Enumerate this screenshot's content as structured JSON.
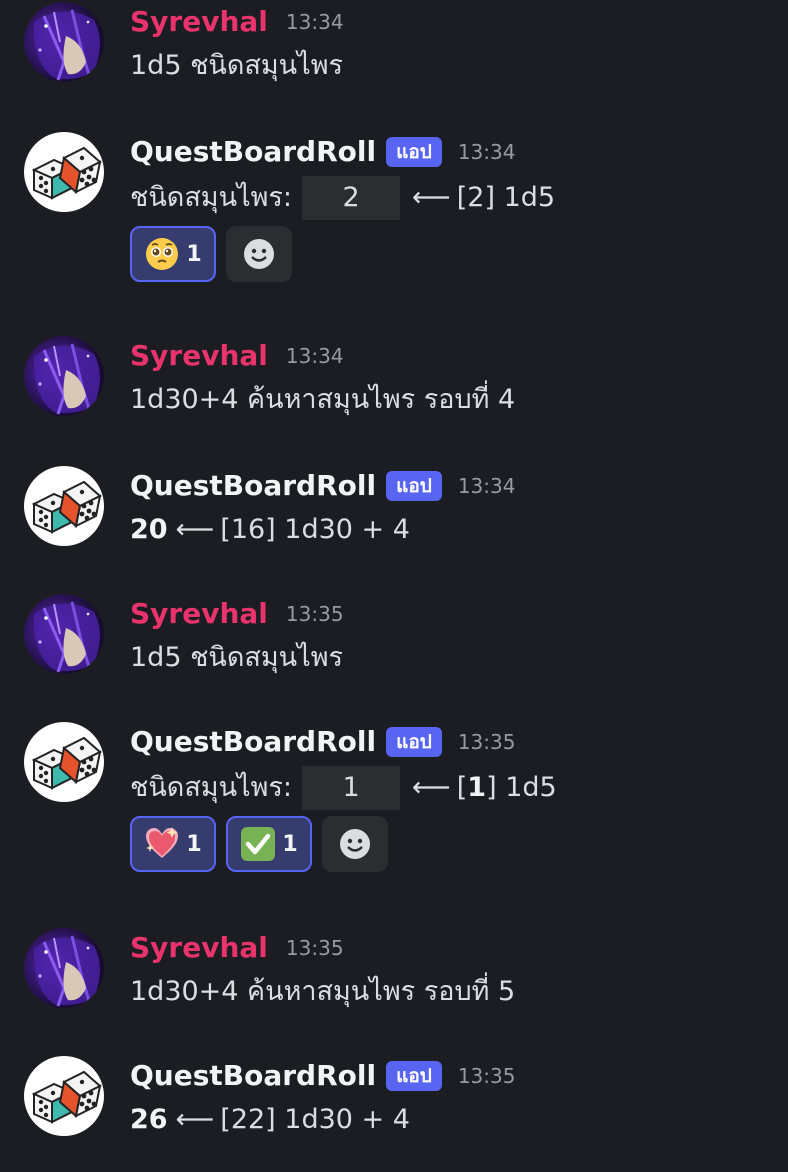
{
  "messages": [
    {
      "author": "Syrevhal",
      "time": "13:34",
      "content": "1d5 ชนิดสมุนไพร"
    },
    {
      "author": "QuestBoardRoll",
      "tag": "แอป",
      "time": "13:34",
      "label": "ชนิดสมุนไพร:",
      "result": "2",
      "detail": "[2] 1d5",
      "reactions": [
        {
          "emoji": "pleading-face-icon",
          "count": "1"
        }
      ]
    },
    {
      "author": "Syrevhal",
      "time": "13:34",
      "content": "1d30+4 ค้นหาสมุนไพร รอบที่ 4"
    },
    {
      "author": "QuestBoardRoll",
      "tag": "แอป",
      "time": "13:34",
      "total": "20",
      "detail": "[16] 1d30 + 4"
    },
    {
      "author": "Syrevhal",
      "time": "13:35",
      "content": "1d5 ชนิดสมุนไพร"
    },
    {
      "author": "QuestBoardRoll",
      "tag": "แอป",
      "time": "13:35",
      "label": "ชนิดสมุนไพร:",
      "result": "1",
      "detail_open": "[",
      "detail_bold": "1",
      "detail_close": "] 1d5",
      "reactions": [
        {
          "emoji": "sparkling-heart-icon",
          "count": "1"
        },
        {
          "emoji": "check-mark-button-icon",
          "count": "1"
        }
      ]
    },
    {
      "author": "Syrevhal",
      "time": "13:35",
      "content": "1d30+4 ค้นหาสมุนไพร รอบที่ 5"
    },
    {
      "author": "QuestBoardRoll",
      "tag": "แอป",
      "time": "13:35",
      "total": "26",
      "detail": "[22] 1d30 + 4"
    }
  ],
  "arrow_glyph": "⟵",
  "colors": {
    "background": "#1c1d22",
    "user_name": "#e8336d",
    "app_tag": "#5865f2",
    "reaction_active_bg": "#373c6e"
  }
}
